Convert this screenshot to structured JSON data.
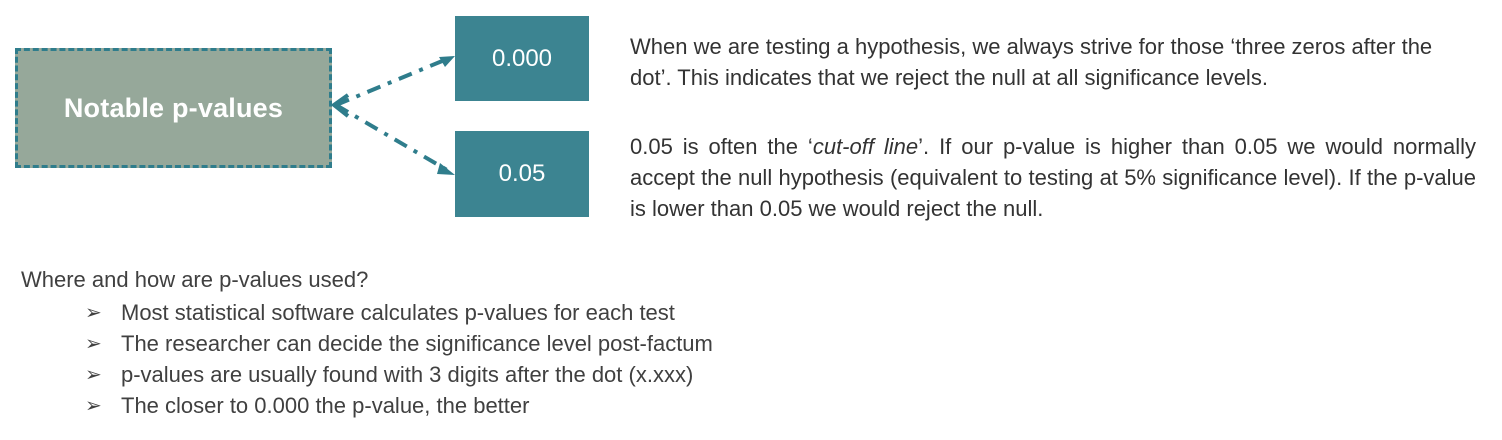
{
  "diagram": {
    "main_label": "Notable p-values",
    "value_top": "0.000",
    "value_bottom": "0.05",
    "colors": {
      "main_fill": "#96a89a",
      "dash": "#2f7d8c",
      "value_fill": "#3c8491"
    }
  },
  "descriptions": {
    "first": "When we are testing a hypothesis, we always strive for those ‘three zeros after the dot’. This indicates that we reject the null at all significance levels.",
    "second_before": "0.05 is often the ‘",
    "second_italic": "cut-off line",
    "second_after": "’. If our p-value is higher than 0.05 we would normally accept the null hypothesis (equivalent to testing at 5% significance level). If the p-value is lower than 0.05 we would reject the null."
  },
  "usage": {
    "question": "Where and how are p-values used?",
    "bullet_icon": "arrowhead-bullet-icon",
    "bullets": [
      "Most statistical software calculates p-values for each test",
      "The researcher can decide the significance level post-factum",
      "p-values are usually found with 3 digits after the dot (x.xxx)",
      "The closer to 0.000 the p-value, the better"
    ]
  }
}
